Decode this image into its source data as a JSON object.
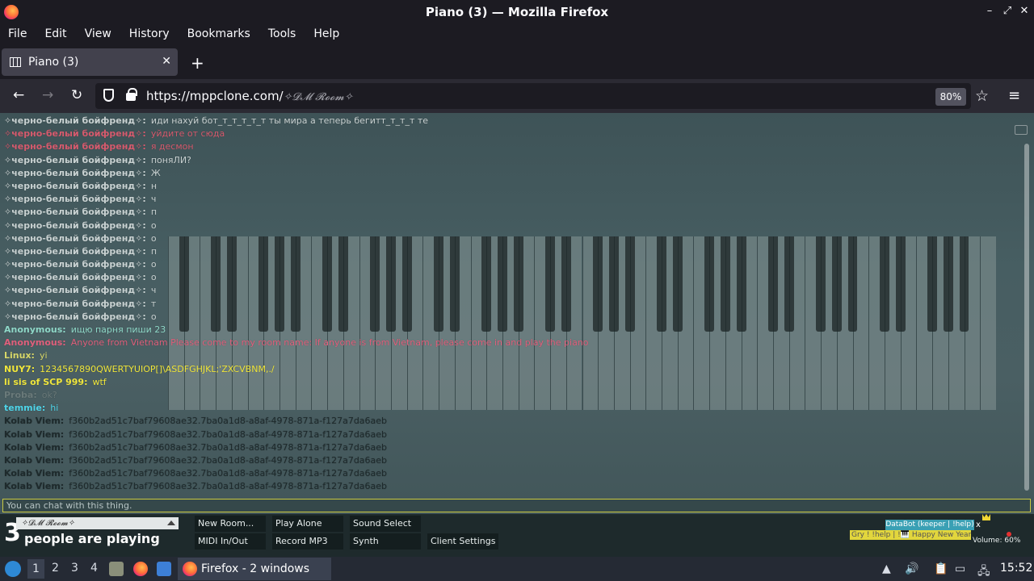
{
  "window": {
    "title": "Piano (3) — Mozilla Firefox"
  },
  "menu": [
    "File",
    "Edit",
    "View",
    "History",
    "Bookmarks",
    "Tools",
    "Help"
  ],
  "tab": {
    "title": "Piano (3)"
  },
  "nav": {
    "url_domain": "https://mppclone.com/",
    "url_path": "✧𝓓𝓜 𝓡𝓸𝓸𝓶✧",
    "zoom": "80%"
  },
  "chat": {
    "messages": [
      {
        "name": "✧черно-белый бойфренд✧:",
        "text": "иди нахуй бот_т_т_т_т_т ты мира а теперь бегитт_т_т_т те",
        "name_color": "#c9d2d2",
        "text_color": "#c9d2d2"
      },
      {
        "name": "✧черно-белый бойфренд✧:",
        "text": "уйдите от сюда",
        "name_color": "#d65b6e",
        "text_color": "#d65b6e"
      },
      {
        "name": "✧черно-белый бойфренд✧:",
        "text": "я десмон",
        "name_color": "#d65b6e",
        "text_color": "#d65b6e"
      },
      {
        "name": "✧черно-белый бойфренд✧:",
        "text": "поняЛИ?",
        "name_color": "#c9d2d2",
        "text_color": "#c9d2d2"
      },
      {
        "name": "✧черно-белый бойфренд✧:",
        "text": "Ж",
        "name_color": "#c9d2d2",
        "text_color": "#c9d2d2"
      },
      {
        "name": "✧черно-белый бойфренд✧:",
        "text": "н",
        "name_color": "#c9d2d2",
        "text_color": "#c9d2d2"
      },
      {
        "name": "✧черно-белый бойфренд✧:",
        "text": "ч",
        "name_color": "#c9d2d2",
        "text_color": "#c9d2d2"
      },
      {
        "name": "✧черно-белый бойфренд✧:",
        "text": "п",
        "name_color": "#c9d2d2",
        "text_color": "#c9d2d2"
      },
      {
        "name": "✧черно-белый бойфренд✧:",
        "text": "о",
        "name_color": "#c9d2d2",
        "text_color": "#c9d2d2"
      },
      {
        "name": "✧черно-белый бойфренд✧:",
        "text": "о",
        "name_color": "#c9d2d2",
        "text_color": "#c9d2d2"
      },
      {
        "name": "✧черно-белый бойфренд✧:",
        "text": "п",
        "name_color": "#c9d2d2",
        "text_color": "#c9d2d2"
      },
      {
        "name": "✧черно-белый бойфренд✧:",
        "text": "о",
        "name_color": "#c9d2d2",
        "text_color": "#c9d2d2"
      },
      {
        "name": "✧черно-белый бойфренд✧:",
        "text": "о",
        "name_color": "#c9d2d2",
        "text_color": "#c9d2d2"
      },
      {
        "name": "✧черно-белый бойфренд✧:",
        "text": "ч",
        "name_color": "#c9d2d2",
        "text_color": "#c9d2d2"
      },
      {
        "name": "✧черно-белый бойфренд✧:",
        "text": "т",
        "name_color": "#c9d2d2",
        "text_color": "#c9d2d2"
      },
      {
        "name": "✧черно-белый бойфренд✧:",
        "text": "о",
        "name_color": "#c9d2d2",
        "text_color": "#c9d2d2"
      },
      {
        "name": "Anonymous:",
        "text": "ищю парня пиши 23",
        "name_color": "#8fd8c8",
        "text_color": "#8fd8c8"
      },
      {
        "name": "Anonymous:",
        "text": "Anyone from Vietnam Please come to my room name: If anyone is from Vietnam, please come in and play the piano",
        "name_color": "#e0607c",
        "text_color": "#e0607c"
      },
      {
        "name": "Linux:",
        "text": "yi",
        "name_color": "#d8d86a",
        "text_color": "#d8d86a"
      },
      {
        "name": "NUY7:",
        "text": "1234567890QWERTYUIOP[]\\ASDFGHJKL;'ZXCVBNM,./",
        "name_color": "#f0e63c",
        "text_color": "#f0e63c"
      },
      {
        "name": "li sis of SCP 999:",
        "text": "wtf",
        "name_color": "#f0e63c",
        "text_color": "#f0e63c"
      },
      {
        "name": "Proba:",
        "text": "ok?",
        "name_color": "#6a7a7a",
        "text_color": "#6a7a7a"
      },
      {
        "name": "temmie:",
        "text": "hi",
        "name_color": "#4fd4e8",
        "text_color": "#4fd4e8"
      },
      {
        "name": "Kolab Viem:",
        "text": "f360b2ad51c7baf79608ae32.7ba0a1d8-a8af-4978-871a-f127a7da6aeb",
        "name_color": "#1e2a2c",
        "text_color": "#1e2a2c"
      },
      {
        "name": "Kolab Viem:",
        "text": "f360b2ad51c7baf79608ae32.7ba0a1d8-a8af-4978-871a-f127a7da6aeb",
        "name_color": "#1e2a2c",
        "text_color": "#1e2a2c"
      },
      {
        "name": "Kolab Viem:",
        "text": "f360b2ad51c7baf79608ae32.7ba0a1d8-a8af-4978-871a-f127a7da6aeb",
        "name_color": "#1e2a2c",
        "text_color": "#1e2a2c"
      },
      {
        "name": "Kolab Viem:",
        "text": "f360b2ad51c7baf79608ae32.7ba0a1d8-a8af-4978-871a-f127a7da6aeb",
        "name_color": "#1e2a2c",
        "text_color": "#1e2a2c"
      },
      {
        "name": "Kolab Viem:",
        "text": "f360b2ad51c7baf79608ae32.7ba0a1d8-a8af-4978-871a-f127a7da6aeb",
        "name_color": "#1e2a2c",
        "text_color": "#1e2a2c"
      },
      {
        "name": "Kolab Viem:",
        "text": "f360b2ad51c7baf79608ae32.7ba0a1d8-a8af-4978-871a-f127a7da6aeb",
        "name_color": "#1e2a2c",
        "text_color": "#1e2a2c"
      }
    ],
    "input_placeholder": "You can chat with this thing."
  },
  "bottom": {
    "count": "3",
    "count_label": "people are playing",
    "room_select": "✧𝓓𝓜 𝓡𝓸𝓸𝓶✧",
    "buttons": [
      "New Room...",
      "Play Alone",
      "Sound Select",
      "MIDI In/Out",
      "Record MP3",
      "Synth",
      "Client Settings"
    ],
    "databot": "DataBot (keeper | !help)",
    "bot_close": "x",
    "yellow_note": "Gry ! !help | !🎹 Happy New Year! | ...",
    "volume": "Volume: 60%"
  },
  "taskbar": {
    "workspaces": [
      "1",
      "2",
      "3",
      "4"
    ],
    "window_label": "Firefox - 2 windows",
    "clock": "15:52"
  }
}
